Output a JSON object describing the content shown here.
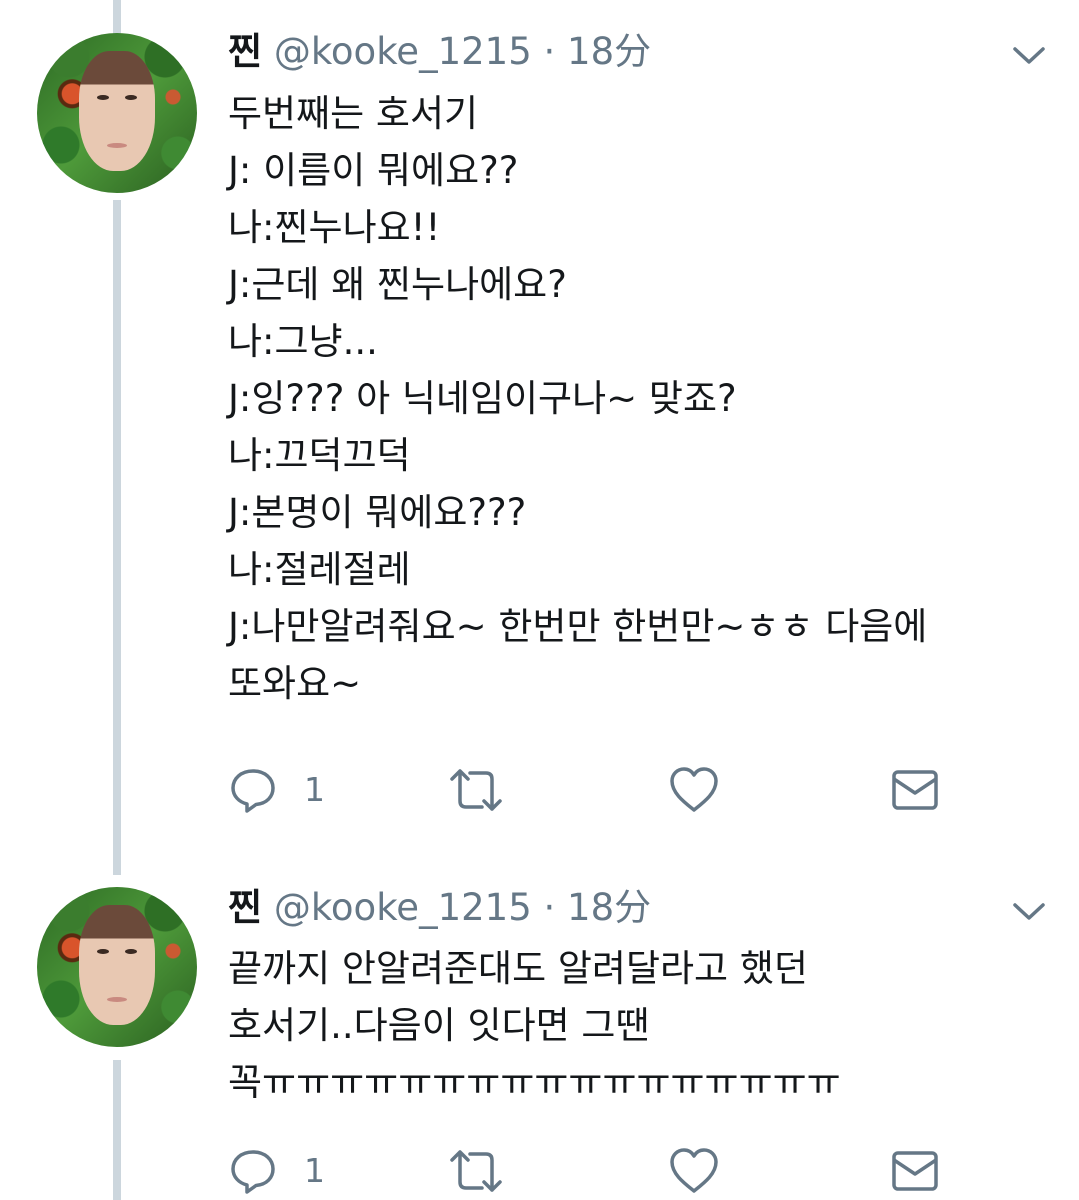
{
  "tweets": [
    {
      "name": "찐",
      "handle": "@kooke_1215",
      "time": "· 18分",
      "lines": [
        "두번째는 호서기",
        "J: 이름이 뭐에요??",
        "나:찐누나요!!",
        "J:근데 왜 찐누나에요?",
        "나:그냥...",
        "J:잉??? 아 닉네임이구나~ 맞죠?",
        "나:끄덕끄덕",
        "J:본명이 뭐에요???",
        "나:절레절레",
        "J:나만알려줘요~ 한번만 한번만~ㅎㅎ 다음에",
        "또와요~"
      ],
      "reply_count": "1",
      "icons": {
        "reply": "speech-bubble-icon",
        "retweet": "retweet-arrows-icon",
        "like": "heart-icon",
        "message": "envelope-icon",
        "menu": "chevron-down-icon"
      }
    },
    {
      "name": "찐",
      "handle": "@kooke_1215",
      "time": "· 18分",
      "lines": [
        "끝까지 안알려준대도 알려달라고 했던",
        "호서기..다음이 잇다면 그땐",
        "꼭ㅠㅠㅠㅠㅠㅠㅠㅠㅠㅠㅠㅠㅠㅠㅠㅠㅠ"
      ],
      "reply_count": "1",
      "icons": {
        "reply": "speech-bubble-icon",
        "retweet": "retweet-arrows-icon",
        "like": "heart-icon",
        "message": "envelope-icon",
        "menu": "chevron-down-icon"
      }
    }
  ],
  "colors": {
    "text": "#14171a",
    "secondary": "#657786",
    "thread_line": "#ccd6dd",
    "icon": "#657786"
  }
}
